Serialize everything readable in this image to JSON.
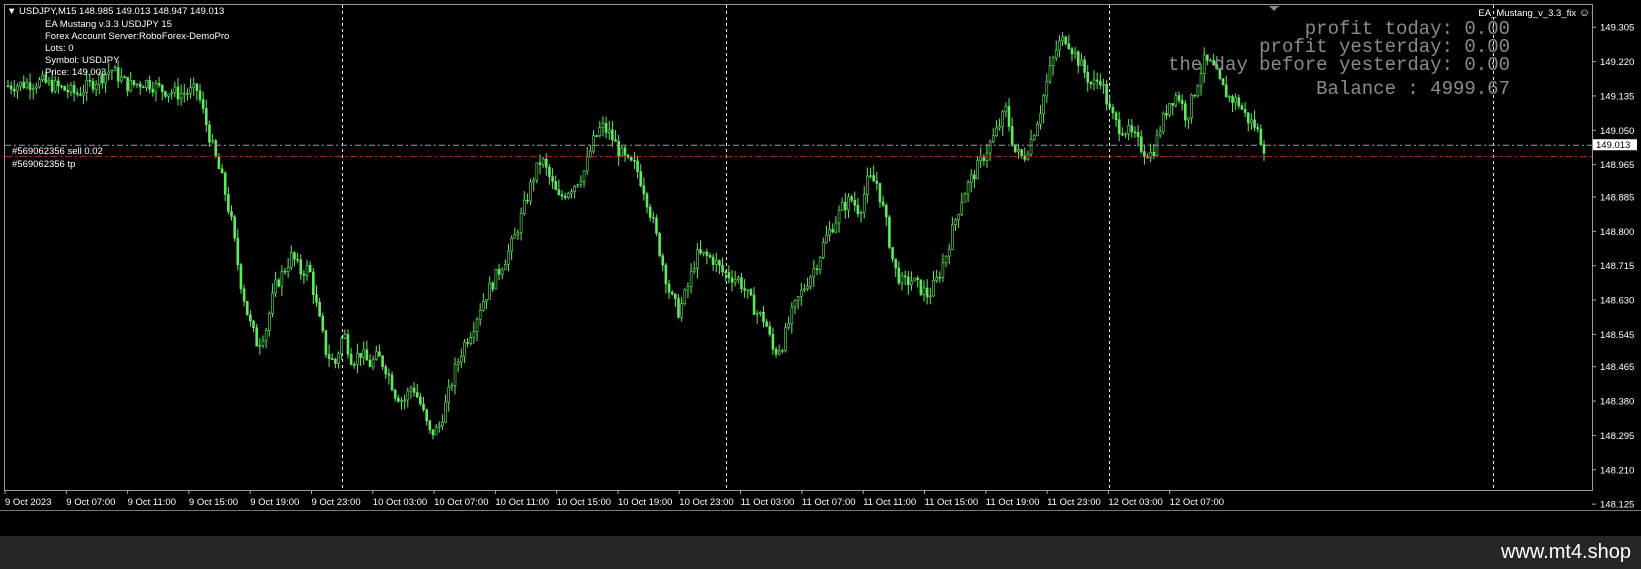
{
  "header": {
    "symbol_line": "USDJPY,M15  148.985 149.013 148.947 149.013",
    "ea_line": "EA Mustang v.3.3 USDJPY  15",
    "server_line": "Forex Account Server:RoboForex-DemoPro",
    "lots_line": "Lots:  0",
    "symbol_name_line": "Symbol: USDJPY",
    "price_line": "Price:  149.003",
    "ea_badge": "EA_Mustang_v_3.3_fix"
  },
  "stats": {
    "profit_today": "profit today: 0.00",
    "profit_yesterday": "profit yesterday: 0.00",
    "day_before": "the day before yesterday: 0.00",
    "balance": "Balance : 4999.67"
  },
  "orders": {
    "sell_label": "#569062356 sell 0.02",
    "tp_label": "#569062356 tp",
    "sell_price": 149.013,
    "tp_price": 148.985,
    "current_price_tag": "149.013"
  },
  "watermark": "www.mt4.shop",
  "colors": {
    "background": "#000000",
    "candle": "#5fea5f",
    "grid": "#ffffff",
    "tp_line": "#c81e1e",
    "sell_line": "#9a9a9a"
  },
  "chart_data": {
    "type": "candlestick",
    "symbol": "USDJPY",
    "timeframe": "M15",
    "ylim": [
      148.16,
      149.36
    ],
    "y_ticks": [
      "149.305",
      "149.220",
      "149.135",
      "149.050",
      "148.965",
      "148.885",
      "148.800",
      "148.715",
      "148.630",
      "148.545",
      "148.465",
      "148.380",
      "148.295",
      "148.210",
      "148.125"
    ],
    "x_ticks": [
      "9 Oct 2023",
      "9 Oct 07:00",
      "9 Oct 11:00",
      "9 Oct 15:00",
      "9 Oct 19:00",
      "9 Oct 23:00",
      "10 Oct 03:00",
      "10 Oct 07:00",
      "10 Oct 11:00",
      "10 Oct 15:00",
      "10 Oct 19:00",
      "10 Oct 23:00",
      "11 Oct 03:00",
      "11 Oct 07:00",
      "11 Oct 11:00",
      "11 Oct 15:00",
      "11 Oct 19:00",
      "11 Oct 23:00",
      "12 Oct 03:00",
      "12 Oct 07:00"
    ],
    "close_path": [
      [
        0,
        149.16
      ],
      [
        4,
        149.17
      ],
      [
        8,
        149.14
      ],
      [
        12,
        149.2
      ],
      [
        14,
        149.16
      ],
      [
        16,
        149.17
      ],
      [
        18,
        149.15
      ],
      [
        20,
        149.14
      ],
      [
        22,
        149.15
      ],
      [
        24,
        148.99
      ],
      [
        25,
        148.92
      ],
      [
        26,
        148.82
      ],
      [
        27,
        148.68
      ],
      [
        28,
        148.58
      ],
      [
        29,
        148.52
      ],
      [
        30,
        148.56
      ],
      [
        31,
        148.66
      ],
      [
        32,
        148.7
      ],
      [
        33,
        148.74
      ],
      [
        34,
        148.7
      ],
      [
        35,
        148.71
      ],
      [
        36,
        148.6
      ],
      [
        37,
        148.5
      ],
      [
        38,
        148.47
      ],
      [
        39,
        148.55
      ],
      [
        40,
        148.48
      ],
      [
        41,
        148.5
      ],
      [
        42,
        148.47
      ],
      [
        43,
        148.49
      ],
      [
        44,
        148.46
      ],
      [
        45,
        148.4
      ],
      [
        46,
        148.38
      ],
      [
        47,
        148.42
      ],
      [
        48,
        148.37
      ],
      [
        49,
        148.3
      ],
      [
        50,
        148.31
      ],
      [
        51,
        148.38
      ],
      [
        52,
        148.46
      ],
      [
        53,
        148.52
      ],
      [
        54,
        148.56
      ],
      [
        55,
        148.62
      ],
      [
        56,
        148.66
      ],
      [
        57,
        148.7
      ],
      [
        58,
        148.74
      ],
      [
        59,
        148.79
      ],
      [
        60,
        148.86
      ],
      [
        61,
        148.93
      ],
      [
        62,
        148.98
      ],
      [
        63,
        148.93
      ],
      [
        64,
        148.88
      ],
      [
        65,
        148.9
      ],
      [
        66,
        148.92
      ],
      [
        67,
        148.95
      ],
      [
        68,
        149.02
      ],
      [
        69,
        149.06
      ],
      [
        70,
        149.04
      ],
      [
        71,
        149.0
      ],
      [
        72,
        148.97
      ],
      [
        73,
        148.96
      ],
      [
        74,
        148.9
      ],
      [
        75,
        148.82
      ],
      [
        76,
        148.73
      ],
      [
        77,
        148.64
      ],
      [
        78,
        148.6
      ],
      [
        79,
        148.66
      ],
      [
        80,
        148.74
      ],
      [
        81,
        148.74
      ],
      [
        82,
        148.73
      ],
      [
        83,
        148.7
      ],
      [
        84,
        148.69
      ],
      [
        85,
        148.68
      ],
      [
        86,
        148.64
      ],
      [
        87,
        148.6
      ],
      [
        88,
        148.58
      ],
      [
        89,
        148.5
      ],
      [
        90,
        148.52
      ],
      [
        91,
        148.59
      ],
      [
        92,
        148.64
      ],
      [
        93,
        148.68
      ],
      [
        94,
        148.72
      ],
      [
        95,
        148.78
      ],
      [
        96,
        148.82
      ],
      [
        97,
        148.86
      ],
      [
        98,
        148.88
      ],
      [
        99,
        148.85
      ],
      [
        100,
        148.93
      ],
      [
        101,
        148.92
      ],
      [
        102,
        148.83
      ],
      [
        103,
        148.71
      ],
      [
        104,
        148.67
      ],
      [
        105,
        148.68
      ],
      [
        106,
        148.66
      ],
      [
        107,
        148.64
      ],
      [
        108,
        148.68
      ],
      [
        109,
        148.74
      ],
      [
        110,
        148.82
      ],
      [
        111,
        148.89
      ],
      [
        112,
        148.93
      ],
      [
        113,
        148.97
      ],
      [
        114,
        149.01
      ],
      [
        115,
        149.05
      ],
      [
        116,
        149.1
      ],
      [
        117,
        149.0
      ],
      [
        118,
        148.98
      ],
      [
        119,
        149.03
      ],
      [
        120,
        149.1
      ],
      [
        121,
        149.19
      ],
      [
        122,
        149.26
      ],
      [
        123,
        149.28
      ],
      [
        124,
        149.24
      ],
      [
        125,
        149.2
      ],
      [
        126,
        149.16
      ],
      [
        127,
        149.18
      ],
      [
        128,
        149.1
      ],
      [
        129,
        149.06
      ],
      [
        130,
        149.05
      ],
      [
        131,
        149.03
      ],
      [
        132,
        149.0
      ],
      [
        133,
        148.99
      ],
      [
        134,
        149.06
      ],
      [
        135,
        149.12
      ],
      [
        136,
        149.14
      ],
      [
        137,
        149.08
      ],
      [
        138,
        149.15
      ],
      [
        139,
        149.22
      ],
      [
        140,
        149.21
      ],
      [
        141,
        149.16
      ],
      [
        142,
        149.13
      ],
      [
        143,
        149.12
      ],
      [
        144,
        149.08
      ],
      [
        145,
        149.06
      ],
      [
        146,
        149.01
      ]
    ]
  }
}
